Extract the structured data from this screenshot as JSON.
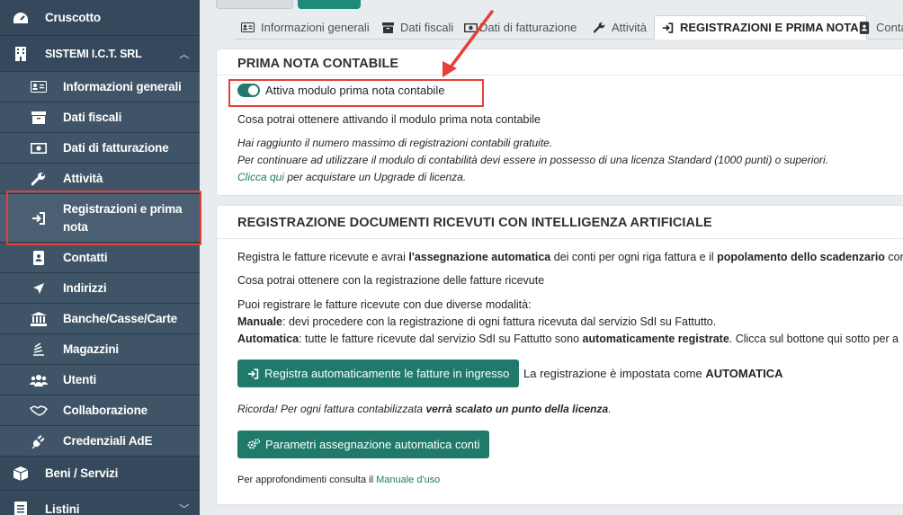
{
  "sidebar": {
    "items": [
      {
        "label": "Cruscotto",
        "icon": "dashboard-icon"
      },
      {
        "label": "SISTEMI I.C.T. SRL",
        "icon": "building-icon"
      },
      {
        "label": "Informazioni generali",
        "icon": "id-card-icon"
      },
      {
        "label": "Dati fiscali",
        "icon": "archive-icon"
      },
      {
        "label": "Dati di fatturazione",
        "icon": "money-bill-icon"
      },
      {
        "label": "Attività",
        "icon": "wrench-icon"
      },
      {
        "label": "Registrazioni e prima nota",
        "icon": "sign-in-icon"
      },
      {
        "label": "Contatti",
        "icon": "address-book-icon"
      },
      {
        "label": "Indirizzi",
        "icon": "location-arrow-icon"
      },
      {
        "label": "Banche/Casse/Carte",
        "icon": "bank-icon"
      },
      {
        "label": "Magazzini",
        "icon": "stack-icon"
      },
      {
        "label": "Utenti",
        "icon": "users-icon"
      },
      {
        "label": "Collaborazione",
        "icon": "handshake-icon"
      },
      {
        "label": "Credenziali AdE",
        "icon": "plug-icon"
      },
      {
        "label": "Beni / Servizi",
        "icon": "box-icon"
      },
      {
        "label": "Listini",
        "icon": "list-icon"
      }
    ]
  },
  "tabs": [
    {
      "label": "Informazioni generali",
      "icon": "id-card-icon"
    },
    {
      "label": "Dati fiscali",
      "icon": "archive-icon"
    },
    {
      "label": "Dati di fatturazione",
      "icon": "money-bill-icon"
    },
    {
      "label": "Attività",
      "icon": "wrench-icon"
    },
    {
      "label": "REGISTRAZIONI E PRIMA NOTA",
      "icon": "sign-in-icon",
      "active": true
    },
    {
      "label": "Conta",
      "icon": "address-book-icon"
    }
  ],
  "prima_nota": {
    "title": "PRIMA NOTA CONTABILE",
    "toggle_label": "Attiva modulo prima nota contabile",
    "toggle_on": true,
    "info_link": "Cosa potrai ottenere attivando il modulo prima nota contabile",
    "warning_line1": "Hai raggiunto il numero massimo di registrazioni contabili gratuite.",
    "warning_line2": "Per continuare ad utilizzare il modulo di contabilità devi essere in possesso di una licenza Standard (1000 punti) o superiori.",
    "upgrade_link": "Clicca qui",
    "upgrade_rest": " per acquistare un Upgrade di licenza."
  },
  "registrazione_ai": {
    "title": "REGISTRAZIONE DOCUMENTI RICEVUTI CON INTELLIGENZA ARTIFICIALE",
    "intro_a": "Registra le fatture ricevute e avrai ",
    "intro_b": "l'assegnazione automatica",
    "intro_c": " dei conti per ogni riga fattura e il ",
    "intro_d": "popolamento dello scadenzario",
    "intro_e": " con",
    "info_link": "Cosa potrai ottenere con la registrazione delle fatture ricevute",
    "modes_intro": "Puoi registrare le fatture ricevute con due diverse modalità:",
    "manual_label": "Manuale",
    "manual_text": ": devi procedere con la registrazione di ogni fattura ricevuta dal servizio SdI su Fattutto.",
    "auto_label": "Automatica",
    "auto_text_a": ": tutte le fatture ricevute dal servizio SdI su Fattutto sono ",
    "auto_text_b": "automaticamente registrate",
    "auto_text_c": ". Clicca sul bottone qui sotto per a",
    "register_button": "Registra automaticamente le fatture in ingresso",
    "status_text": "La registrazione è impostata come ",
    "status_value": "AUTOMATICA",
    "reminder_a": "Ricorda! Per ogni fattura contabilizzata ",
    "reminder_b": "verrà scalato un punto della licenza",
    "reminder_c": ".",
    "params_button": "Parametri assegnazione automatica conti",
    "footer_text": "Per approfondimenti consulta il ",
    "footer_link": "Manuale d'uso"
  },
  "colors": {
    "sidebar_bg": "#36495c",
    "accent": "#1f7a6b",
    "highlight": "#e4403a"
  }
}
